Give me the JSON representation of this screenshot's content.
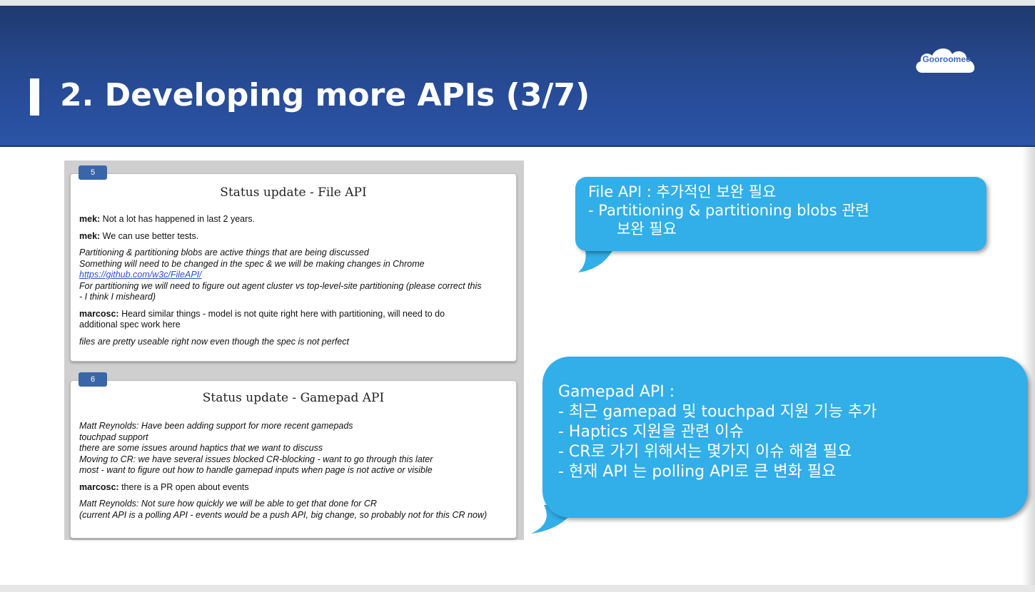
{
  "header": {
    "title": "2. Developing more APIs (3/7)",
    "logo_text": "Gooroomee"
  },
  "card1": {
    "number": "5",
    "title": "Status update - File API",
    "lines": [
      {
        "speaker": "mek:",
        "text": " Not a lot has happened in last 2 years."
      },
      {
        "speaker": "mek:",
        "text": " We can use better tests."
      },
      {
        "italic1": "Partitioning & partitioning blobs are active things that are being discussed",
        "italic2": "Something will need to be changed in the spec & we will be making changes in Chrome",
        "link": "https://github.com/w3c/FileAPI/",
        "italic3": "For partitioning we will need to figure out agent cluster vs top-level-site partitioning (please correct this",
        "italic4": "- I think I misheard)"
      },
      {
        "speaker": "marcosc:",
        "text": " Heard similar things - model is not quite right here with partitioning, will need to do",
        "text2": "additional spec work here"
      },
      {
        "italic1": "files are pretty useable right now even though the spec is not perfect"
      }
    ]
  },
  "card2": {
    "number": "6",
    "title": "Status update - Gamepad API",
    "lines": [
      {
        "italic1": "Matt Reynolds: Have been adding support for more recent gamepads",
        "italic2": "touchpad support",
        "italic3": "there are some issues around haptics that we want to discuss",
        "italic4": "Moving to CR: we have several issues blocked CR-blocking - want to go through this later",
        "italic5": "most - want to figure out how to handle gamepad inputs when page is not active or visible"
      },
      {
        "speaker": "marcosc:",
        "text": " there is a PR open about events"
      },
      {
        "italic1": "Matt Reynolds: Not sure how quickly we will be able to get that done for CR",
        "italic2": "(current API is a polling API - events would be a push API, big change, so probably not for this CR now)"
      }
    ]
  },
  "bubble1": {
    "heading": "File API : 추가적인 보완 필요",
    "items": [
      "-   Partitioning & partitioning blobs 관련",
      "보완 필요"
    ]
  },
  "bubble2": {
    "heading": "Gamepad API :",
    "items": [
      "-   최근 gamepad 및 touchpad 지원 기능 추가",
      "-   Haptics 지원을 관련 이슈",
      "-   CR로 가기 위해서는 몇가지 이슈 해결 필요",
      "-   현재 API 는 polling API로 큰 변화 필요"
    ]
  },
  "colors": {
    "header": "#26488f",
    "bubble": "#32aee8",
    "tag": "#3966a8"
  }
}
